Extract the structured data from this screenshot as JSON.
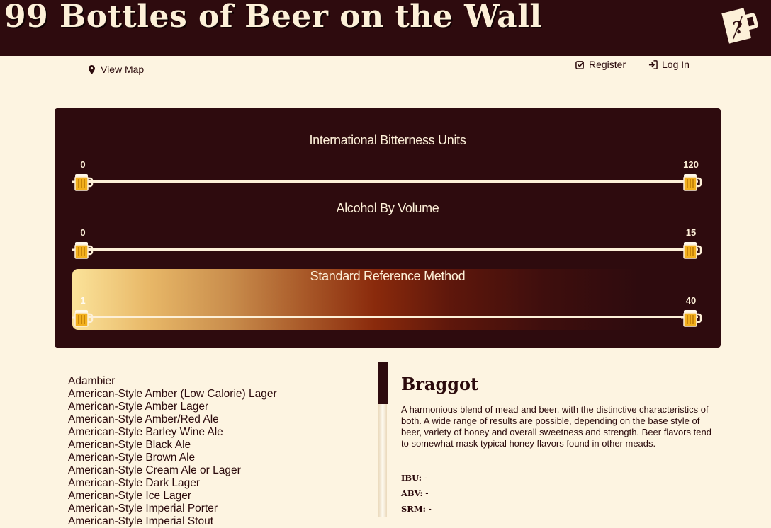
{
  "header": {
    "title": "99 Bottles of Beer on the Wall",
    "logo_icon": "beer-map-question-icon"
  },
  "nav": {
    "view_map": "View Map",
    "register": "Register",
    "login": "Log In"
  },
  "filters": {
    "ibu": {
      "title": "International Bitterness Units",
      "min_label": "0",
      "max_label": "120",
      "low": 0,
      "high": 120
    },
    "abv": {
      "title": "Alcohol By Volume",
      "min_label": "0",
      "max_label": "15",
      "low": 0,
      "high": 15
    },
    "srm": {
      "title": "Standard Reference Method",
      "min_label": "1",
      "max_label": "40",
      "low": 1,
      "high": 40
    }
  },
  "style_list": [
    "Adambier",
    "American-Style Amber (Low Calorie) Lager",
    "American-Style Amber Lager",
    "American-Style Amber/Red Ale",
    "American-Style Barley Wine Ale",
    "American-Style Black Ale",
    "American-Style Brown Ale",
    "American-Style Cream Ale or Lager",
    "American-Style Dark Lager",
    "American-Style Ice Lager",
    "American-Style Imperial Porter",
    "American-Style Imperial Stout"
  ],
  "detail": {
    "title": "Braggot",
    "description": "A harmonious blend of mead and beer, with the distinctive characteristics of both. A wide range of results are possible, depending on the base style of beer, variety of honey and overall sweetness and strength. Beer flavors tend to somewhat mask typical honey flavors found in other meads.",
    "ibu_label": "IBU:",
    "ibu_value": "-",
    "abv_label": "ABV:",
    "abv_value": "-",
    "srm_label": "SRM:",
    "srm_value": "-"
  },
  "colors": {
    "header_bg": "#2e0b0e",
    "page_bg": "#fdf4e1",
    "text": "#2b0a0c",
    "handle_beer": "#f2b01e"
  }
}
